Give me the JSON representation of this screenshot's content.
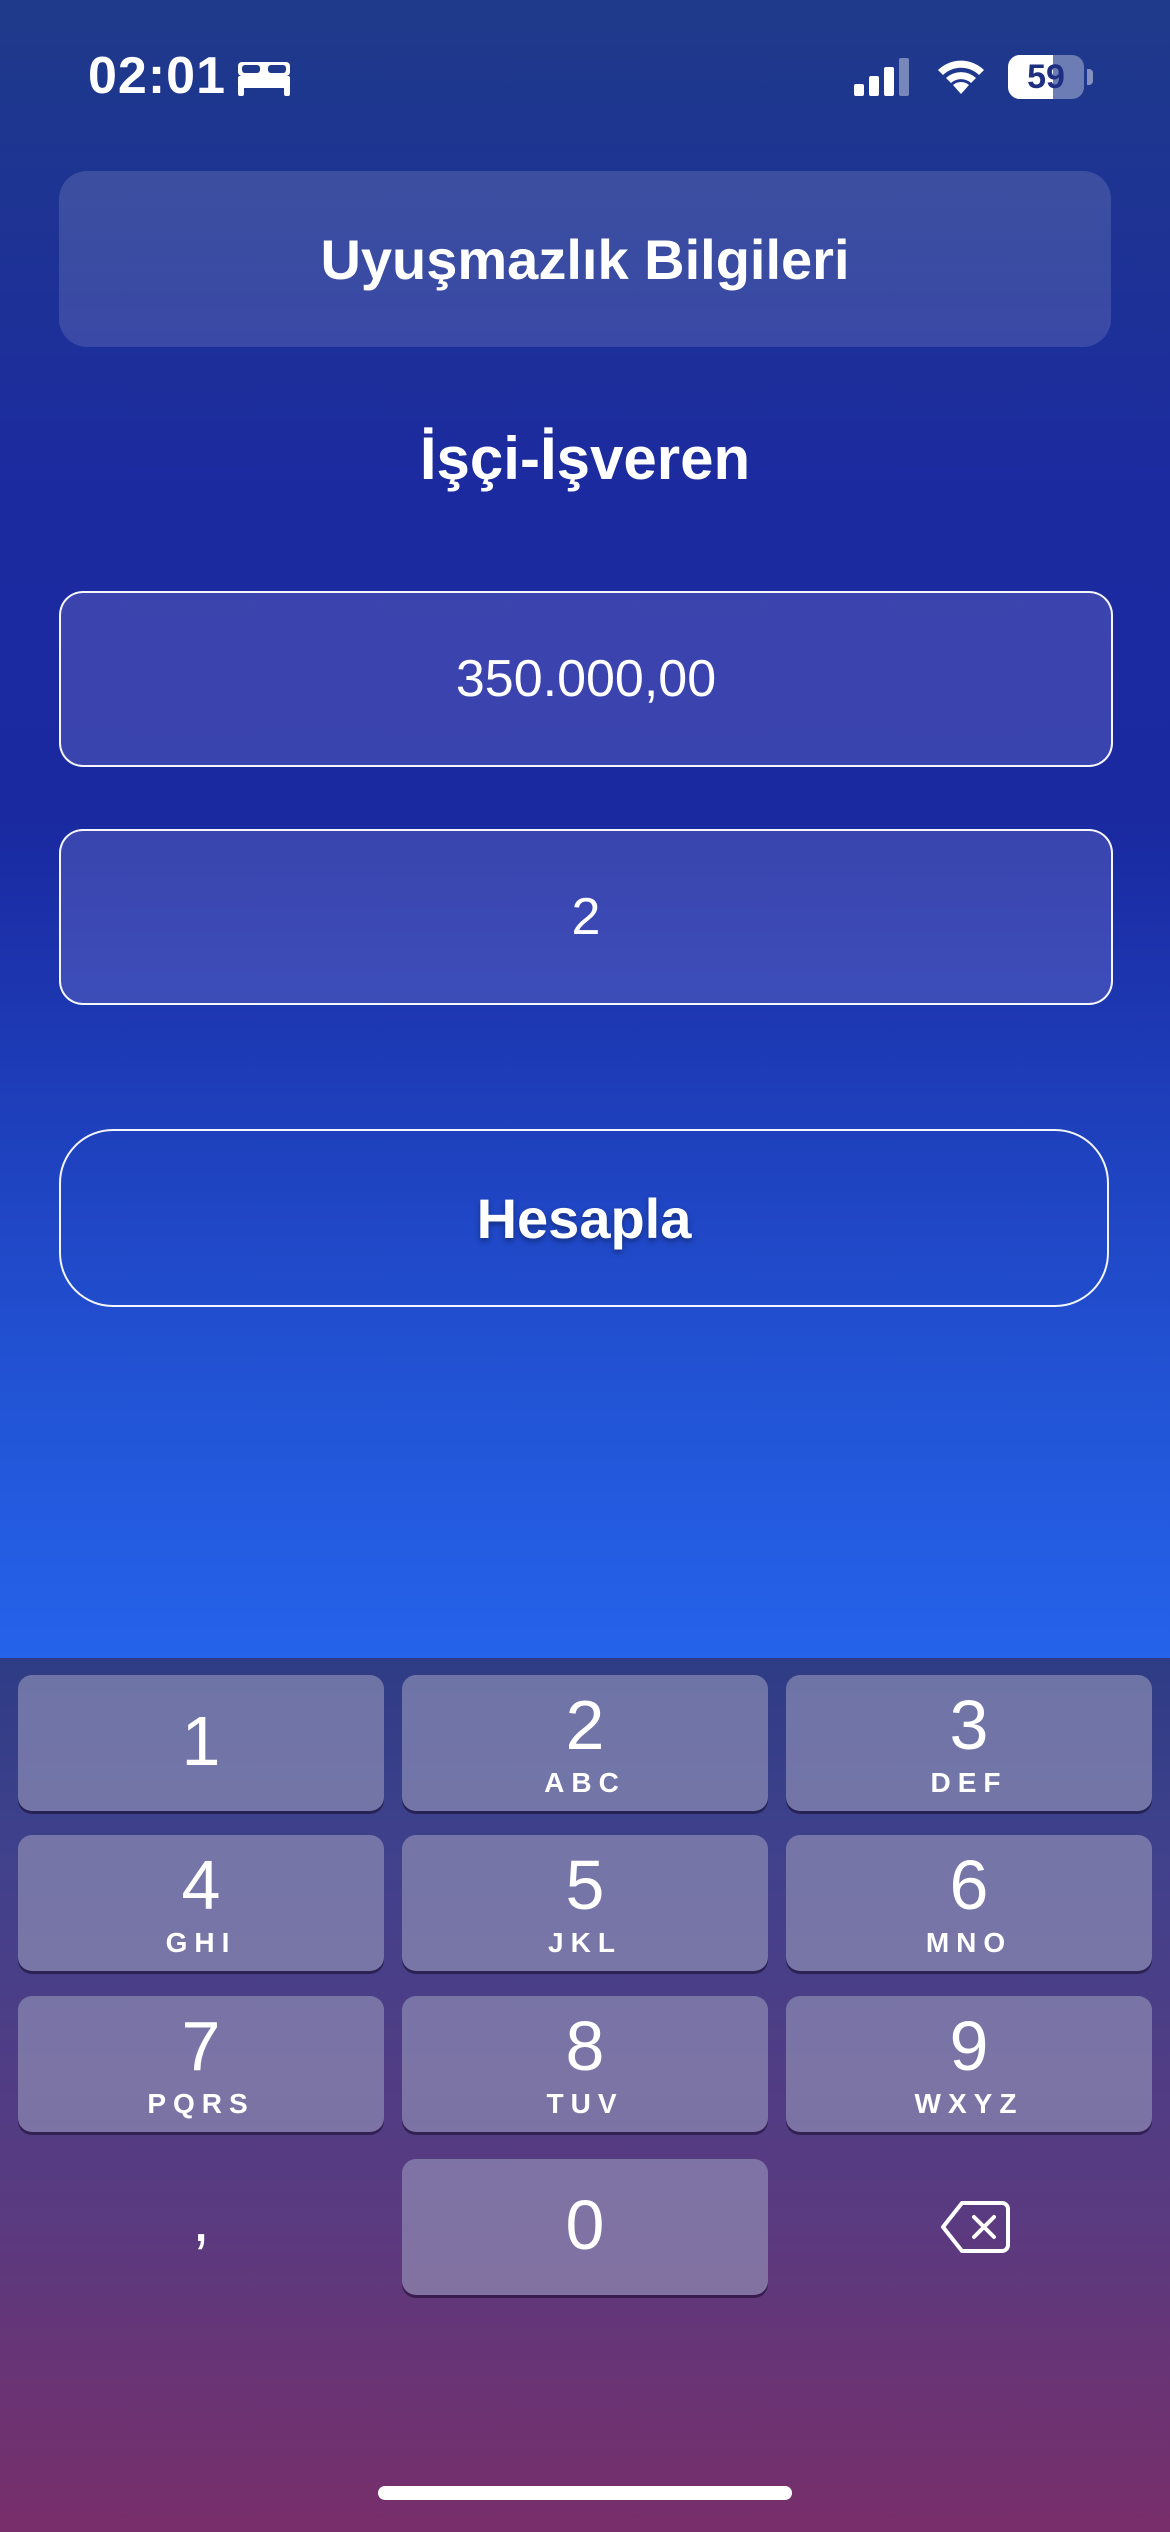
{
  "status_bar": {
    "time": "02:01",
    "battery": "59",
    "battery_level": 0.59,
    "icons": [
      "bed-icon",
      "cellular-signal-icon",
      "wifi-icon",
      "battery-icon"
    ]
  },
  "header": {
    "title": "Uyuşmazlık Bilgileri"
  },
  "subtitle": "İşçi-İşveren",
  "form": {
    "amount_value": "350.000,00",
    "count_value": "2",
    "calculate_label": "Hesapla"
  },
  "keyboard": {
    "keys": [
      {
        "digit": "1",
        "letters": ""
      },
      {
        "digit": "2",
        "letters": "ABC"
      },
      {
        "digit": "3",
        "letters": "DEF"
      },
      {
        "digit": "4",
        "letters": "GHI"
      },
      {
        "digit": "5",
        "letters": "JKL"
      },
      {
        "digit": "6",
        "letters": "MNO"
      },
      {
        "digit": "7",
        "letters": "PQRS"
      },
      {
        "digit": "8",
        "letters": "TUV"
      },
      {
        "digit": "9",
        "letters": "WXYZ"
      },
      {
        "digit": "0",
        "letters": ""
      }
    ],
    "comma": ",",
    "delete_icon": "delete-backspace-icon"
  },
  "colors": {
    "background_top": "#1f3a8a",
    "background_mid": "#1a29a0",
    "background_bottom": "#2563eb",
    "text": "#ffffff"
  }
}
